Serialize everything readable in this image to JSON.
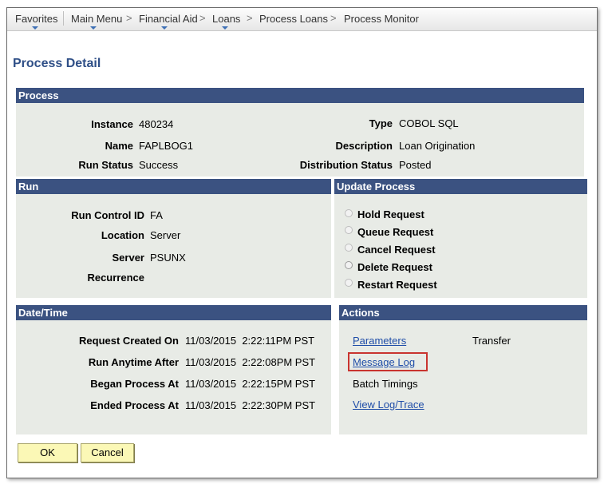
{
  "nav": {
    "favorites": "Favorites",
    "main_menu": "Main Menu",
    "financial_aid": "Financial Aid",
    "loans": "Loans",
    "process_loans": "Process Loans",
    "process_monitor": "Process Monitor",
    "separator": ">"
  },
  "page_title": "Process Detail",
  "process": {
    "header": "Process",
    "instance_label": "Instance",
    "instance_value": "480234",
    "name_label": "Name",
    "name_value": "FAPLBOG1",
    "run_status_label": "Run Status",
    "run_status_value": "Success",
    "type_label": "Type",
    "type_value": "COBOL SQL",
    "description_label": "Description",
    "description_value": "Loan Origination",
    "distribution_status_label": "Distribution Status",
    "distribution_status_value": "Posted"
  },
  "run": {
    "header": "Run",
    "run_control_id_label": "Run Control ID",
    "run_control_id_value": "FA",
    "location_label": "Location",
    "location_value": "Server",
    "server_label": "Server",
    "server_value": "PSUNX",
    "recurrence_label": "Recurrence",
    "recurrence_value": ""
  },
  "update_process": {
    "header": "Update Process",
    "options": [
      "Hold Request",
      "Queue Request",
      "Cancel Request",
      "Delete Request",
      "Restart Request"
    ]
  },
  "date_time": {
    "header": "Date/Time",
    "request_created_label": "Request Created On",
    "request_created_value": "11/03/2015  2:22:11PM PST",
    "run_anytime_label": "Run Anytime After",
    "run_anytime_value": "11/03/2015  2:22:08PM PST",
    "began_label": "Began Process At",
    "began_value": "11/03/2015  2:22:15PM PST",
    "ended_label": "Ended Process At",
    "ended_value": "11/03/2015  2:22:30PM PST"
  },
  "actions": {
    "header": "Actions",
    "parameters": "Parameters",
    "transfer": "Transfer",
    "message_log": "Message Log",
    "batch_timings": "Batch Timings",
    "view_log_trace": "View Log/Trace"
  },
  "buttons": {
    "ok": "OK",
    "cancel": "Cancel"
  },
  "colors": {
    "header_bg": "#3b5281",
    "panel_bg": "#e8ebe6",
    "title": "#2f4f87",
    "link": "#1f4da8",
    "highlight": "#c9342f",
    "button_bg": "#fbf8b6"
  }
}
